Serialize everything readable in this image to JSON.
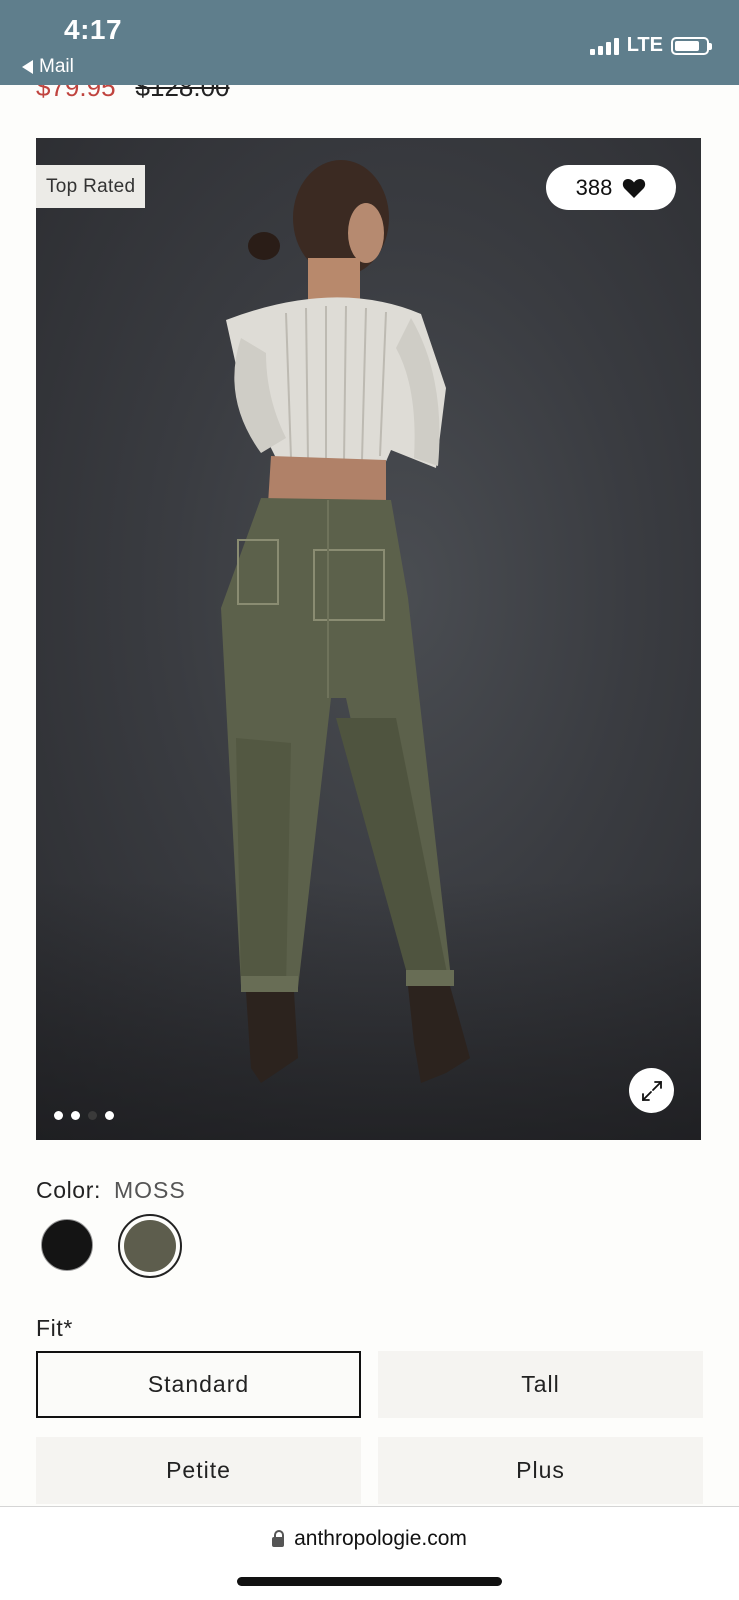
{
  "status_bar": {
    "time": "4:17",
    "back_label": "Mail",
    "network": "LTE",
    "background_color": "#5f7e8c"
  },
  "product": {
    "sale_price": "$79.95",
    "original_price": "$128.00",
    "badge": "Top Rated",
    "likes_count": "388",
    "image_count": 4,
    "active_image_index": 2
  },
  "color": {
    "label": "Color:",
    "selected_value": "MOSS",
    "swatches": [
      {
        "name": "black",
        "hex": "#141414"
      },
      {
        "name": "moss",
        "hex": "#5d5d4d",
        "selected": true
      }
    ]
  },
  "fit": {
    "label": "Fit*",
    "options": [
      {
        "label": "Standard",
        "selected": true
      },
      {
        "label": "Tall",
        "selected": false
      },
      {
        "label": "Petite",
        "selected": false
      },
      {
        "label": "Plus",
        "selected": false
      }
    ]
  },
  "browser": {
    "url": "anthropologie.com"
  },
  "icons": {
    "heart": "heart-icon",
    "expand": "expand-icon",
    "lock": "lock-icon",
    "back": "back-arrow-icon"
  },
  "colors": {
    "sale_red": "#c0443f",
    "text": "#222222",
    "button_bg": "#f5f4f1"
  }
}
